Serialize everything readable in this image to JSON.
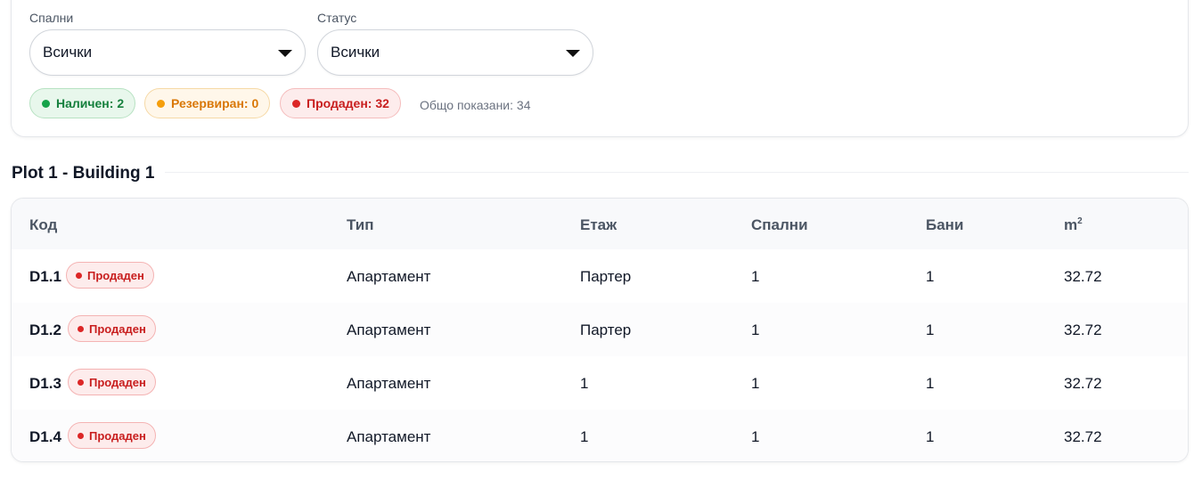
{
  "filters": {
    "bedrooms": {
      "label": "Спални",
      "value": "Всички"
    },
    "status": {
      "label": "Статус",
      "value": "Всички"
    }
  },
  "status_chips": [
    {
      "label": "Наличен: 2",
      "color": "#16a34a"
    },
    {
      "label": "Резервиран: 0",
      "color": "#f59e0b"
    },
    {
      "label": "Продаден: 32",
      "color": "#dc2626"
    }
  ],
  "total_shown": "Общо показани: 34",
  "section": {
    "title": "Plot 1 - Building 1"
  },
  "table": {
    "columns": [
      "Код",
      "Тип",
      "Етаж",
      "Спални",
      "Бани",
      "m"
    ],
    "area_unit_sup": "2",
    "rows": [
      {
        "code": "D1.1",
        "status": "Продаден",
        "type": "Апартамент",
        "floor": "Партер",
        "bedrooms": "1",
        "bathrooms": "1",
        "area": "32.72"
      },
      {
        "code": "D1.2",
        "status": "Продаден",
        "type": "Апартамент",
        "floor": "Партер",
        "bedrooms": "1",
        "bathrooms": "1",
        "area": "32.72"
      },
      {
        "code": "D1.3",
        "status": "Продаден",
        "type": "Апартамент",
        "floor": "1",
        "bedrooms": "1",
        "bathrooms": "1",
        "area": "32.72"
      },
      {
        "code": "D1.4",
        "status": "Продаден",
        "type": "Апартамент",
        "floor": "1",
        "bedrooms": "1",
        "bathrooms": "1",
        "area": "32.72"
      }
    ]
  }
}
